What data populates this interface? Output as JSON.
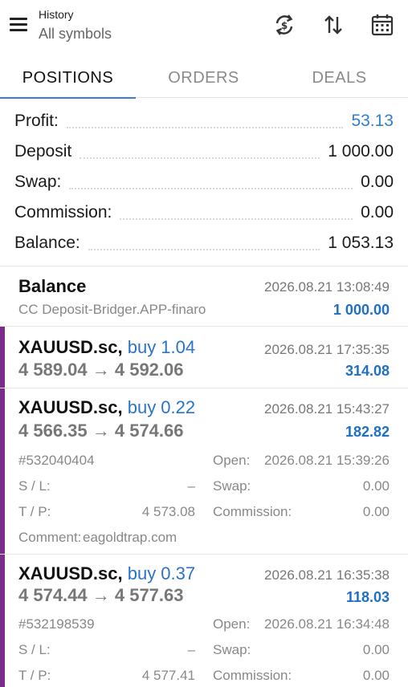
{
  "header": {
    "title": "History",
    "subtitle": "All symbols",
    "icons": [
      "menu-icon",
      "currency-exchange-icon",
      "sort-icon",
      "calendar-icon"
    ]
  },
  "tabs": [
    {
      "label": "POSITIONS",
      "active": true
    },
    {
      "label": "ORDERS",
      "active": false
    },
    {
      "label": "DEALS",
      "active": false
    }
  ],
  "summary": [
    {
      "label": "Profit:",
      "value": "53.13",
      "color": "#2f7fce"
    },
    {
      "label": "Deposit",
      "value": "1 000.00"
    },
    {
      "label": "Swap:",
      "value": "0.00"
    },
    {
      "label": "Commission:",
      "value": "0.00"
    },
    {
      "label": "Balance:",
      "value": "1 053.13"
    }
  ],
  "balance_entry": {
    "title": "Balance",
    "time": "2026.08.21 13:08:49",
    "comment": "CC Deposit-Bridger.APP-finaro",
    "amount": "1 000.00"
  },
  "positions": [
    {
      "symbol": "XAUUSD.sc,",
      "side": "buy 1.04",
      "time": "2026.08.21 17:35:35",
      "prices": "4 589.04 → 4 592.06",
      "profit": "314.08"
    },
    {
      "symbol": "XAUUSD.sc,",
      "side": "buy 0.22",
      "time": "2026.08.21 15:43:27",
      "prices": "4 566.35 → 4 574.66",
      "profit": "182.82",
      "ticket": "#532040404",
      "open_label": "Open:",
      "open_time": "2026.08.21 15:39:26",
      "sl_label": "S / L:",
      "sl": "–",
      "swap_label": "Swap:",
      "swap": "0.00",
      "tp_label": "T / P:",
      "tp": "4 573.08",
      "commission_label": "Commission:",
      "commission": "0.00",
      "comment_label": "Comment:",
      "comment": "eagoldtrap.com"
    },
    {
      "symbol": "XAUUSD.sc,",
      "side": "buy 0.37",
      "time": "2026.08.21 16:35:38",
      "prices": "4 574.44 → 4 577.63",
      "profit": "118.03",
      "ticket": "#532198539",
      "open_label": "Open:",
      "open_time": "2026.08.21 16:34:48",
      "sl_label": "S / L:",
      "sl": "–",
      "swap_label": "Swap:",
      "swap": "0.00",
      "tp_label": "T / P:",
      "tp": "4 577.41",
      "commission_label": "Commission:",
      "commission": "0.00"
    }
  ],
  "colors": {
    "accent": "#3a7bd5",
    "profit_blue": "#1f6fc2",
    "position_bar": "#7b2b8c"
  }
}
